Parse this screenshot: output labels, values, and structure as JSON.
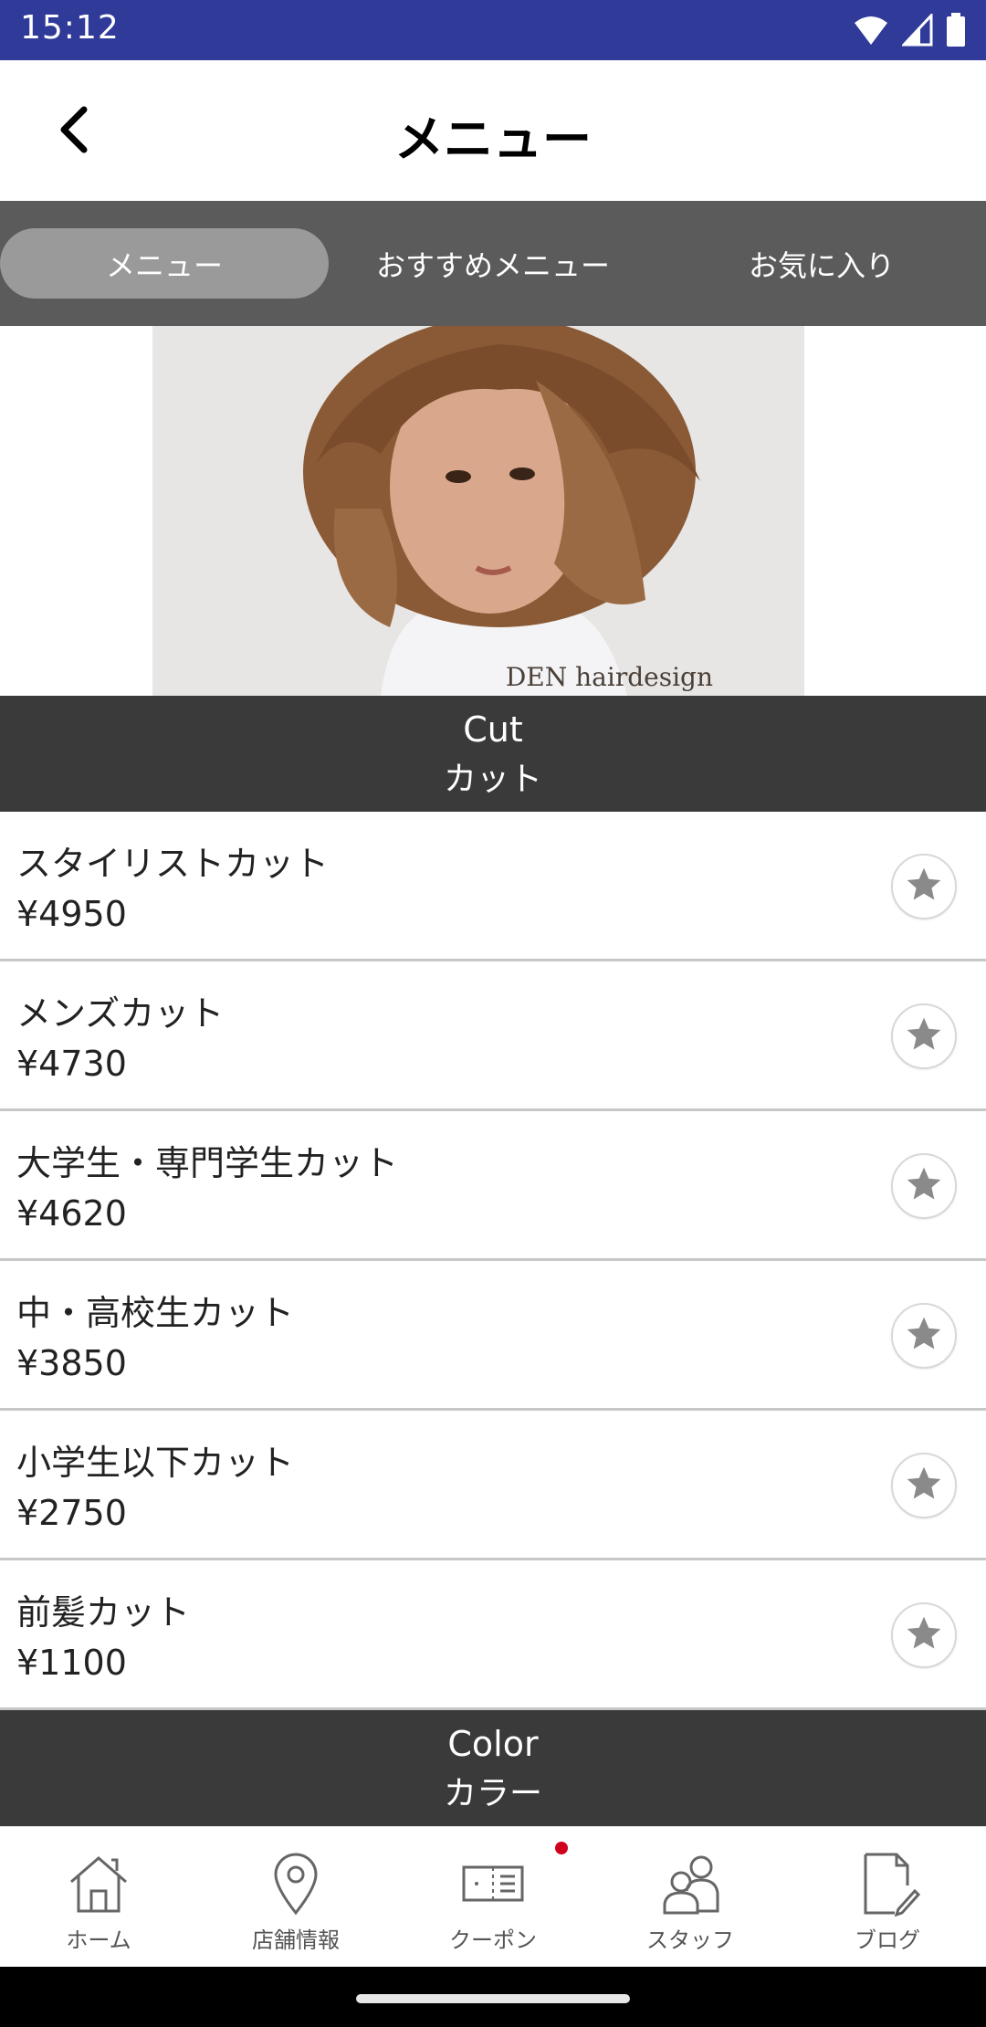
{
  "status_bar": {
    "time": "15:12"
  },
  "header": {
    "title": "メニュー"
  },
  "tabs": [
    {
      "label": "メニュー",
      "active": true
    },
    {
      "label": "おすすめメニュー",
      "active": false
    },
    {
      "label": "お気に入り",
      "active": false
    }
  ],
  "banner": {
    "caption": "DEN hairdesign"
  },
  "sections": {
    "cut": {
      "title_en": "Cut",
      "title_jp": "カット"
    },
    "color": {
      "title_en": "Color",
      "title_jp": "カラー"
    }
  },
  "items": [
    {
      "name": "スタイリストカット",
      "price": "¥4950"
    },
    {
      "name": "メンズカット",
      "price": "¥4730"
    },
    {
      "name": "大学生・専門学生カット",
      "price": "¥4620"
    },
    {
      "name": "中・高校生カット",
      "price": "¥3850"
    },
    {
      "name": "小学生以下カット",
      "price": "¥2750"
    },
    {
      "name": "前髪カット",
      "price": "¥1100"
    }
  ],
  "bottom_nav": [
    {
      "label": "ホーム",
      "icon": "home-icon"
    },
    {
      "label": "店舗情報",
      "icon": "location-pin-icon"
    },
    {
      "label": "クーポン",
      "icon": "coupon-ticket-icon",
      "badge": true
    },
    {
      "label": "スタッフ",
      "icon": "staff-people-icon"
    },
    {
      "label": "ブログ",
      "icon": "blog-edit-icon"
    }
  ],
  "colors": {
    "status_bar": "#2f3a99",
    "tab_bar": "#5c5b5c",
    "tab_active": "#9a9a9a",
    "section_header": "#3a3a3a",
    "badge": "#d0021b"
  }
}
